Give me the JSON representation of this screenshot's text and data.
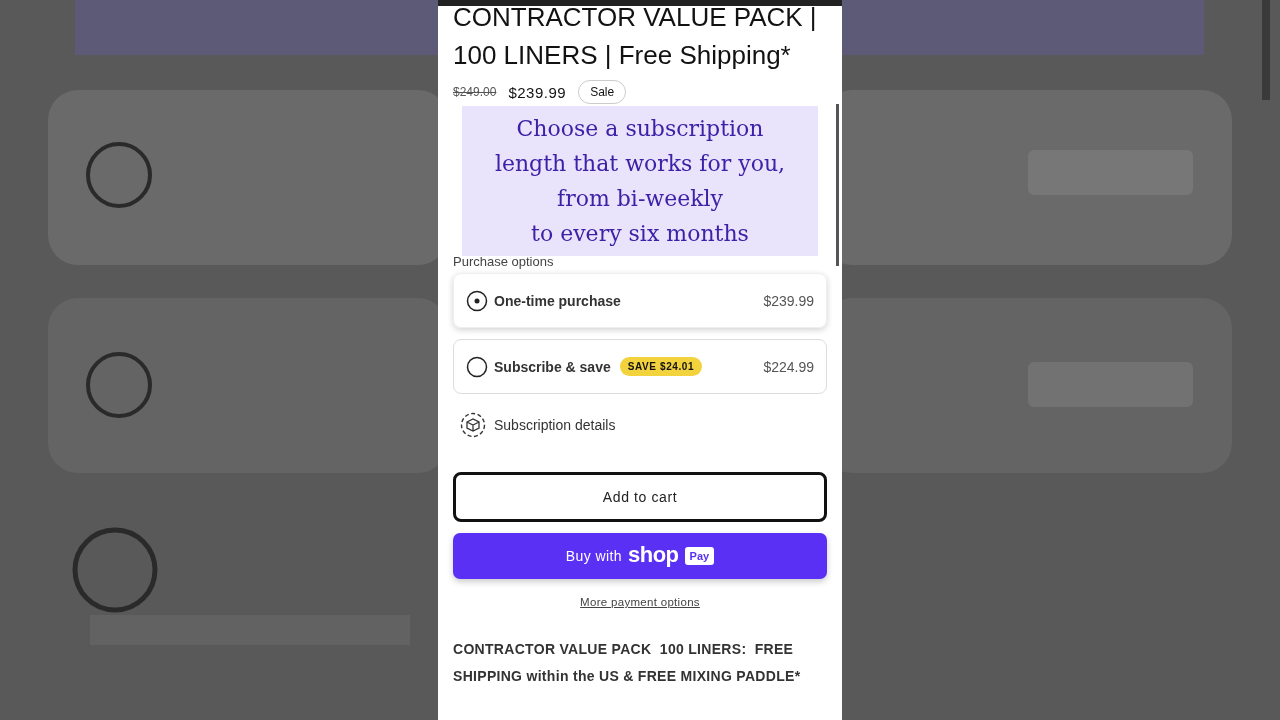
{
  "product": {
    "title_lines": [
      "CONTRACTOR VALUE PACK |",
      "100 LINERS | Free Shipping*"
    ],
    "compare_price": "$249.00",
    "price": "$239.99",
    "badge": "Sale"
  },
  "caption": {
    "lines": [
      "Choose a subscription",
      "length that works for you,",
      "from bi-weekly",
      "to every six months"
    ]
  },
  "purchase_options": {
    "label": "Purchase options",
    "options": [
      {
        "label": "One-time purchase",
        "price": "$239.99",
        "selected": true
      },
      {
        "label": "Subscribe & save",
        "badge": "SAVE $24.01",
        "price": "$224.99",
        "selected": false
      }
    ]
  },
  "subscription_details": "Subscription details",
  "add_to_cart": "Add to cart",
  "shop_pay": {
    "prefix": "Buy with",
    "brand": "shop",
    "badge": "Pay"
  },
  "more_payment": "More payment options",
  "description": "CONTRACTOR VALUE PACK  100 LINERS:  FREE SHIPPING within the US & FREE MIXING PADDLE*"
}
